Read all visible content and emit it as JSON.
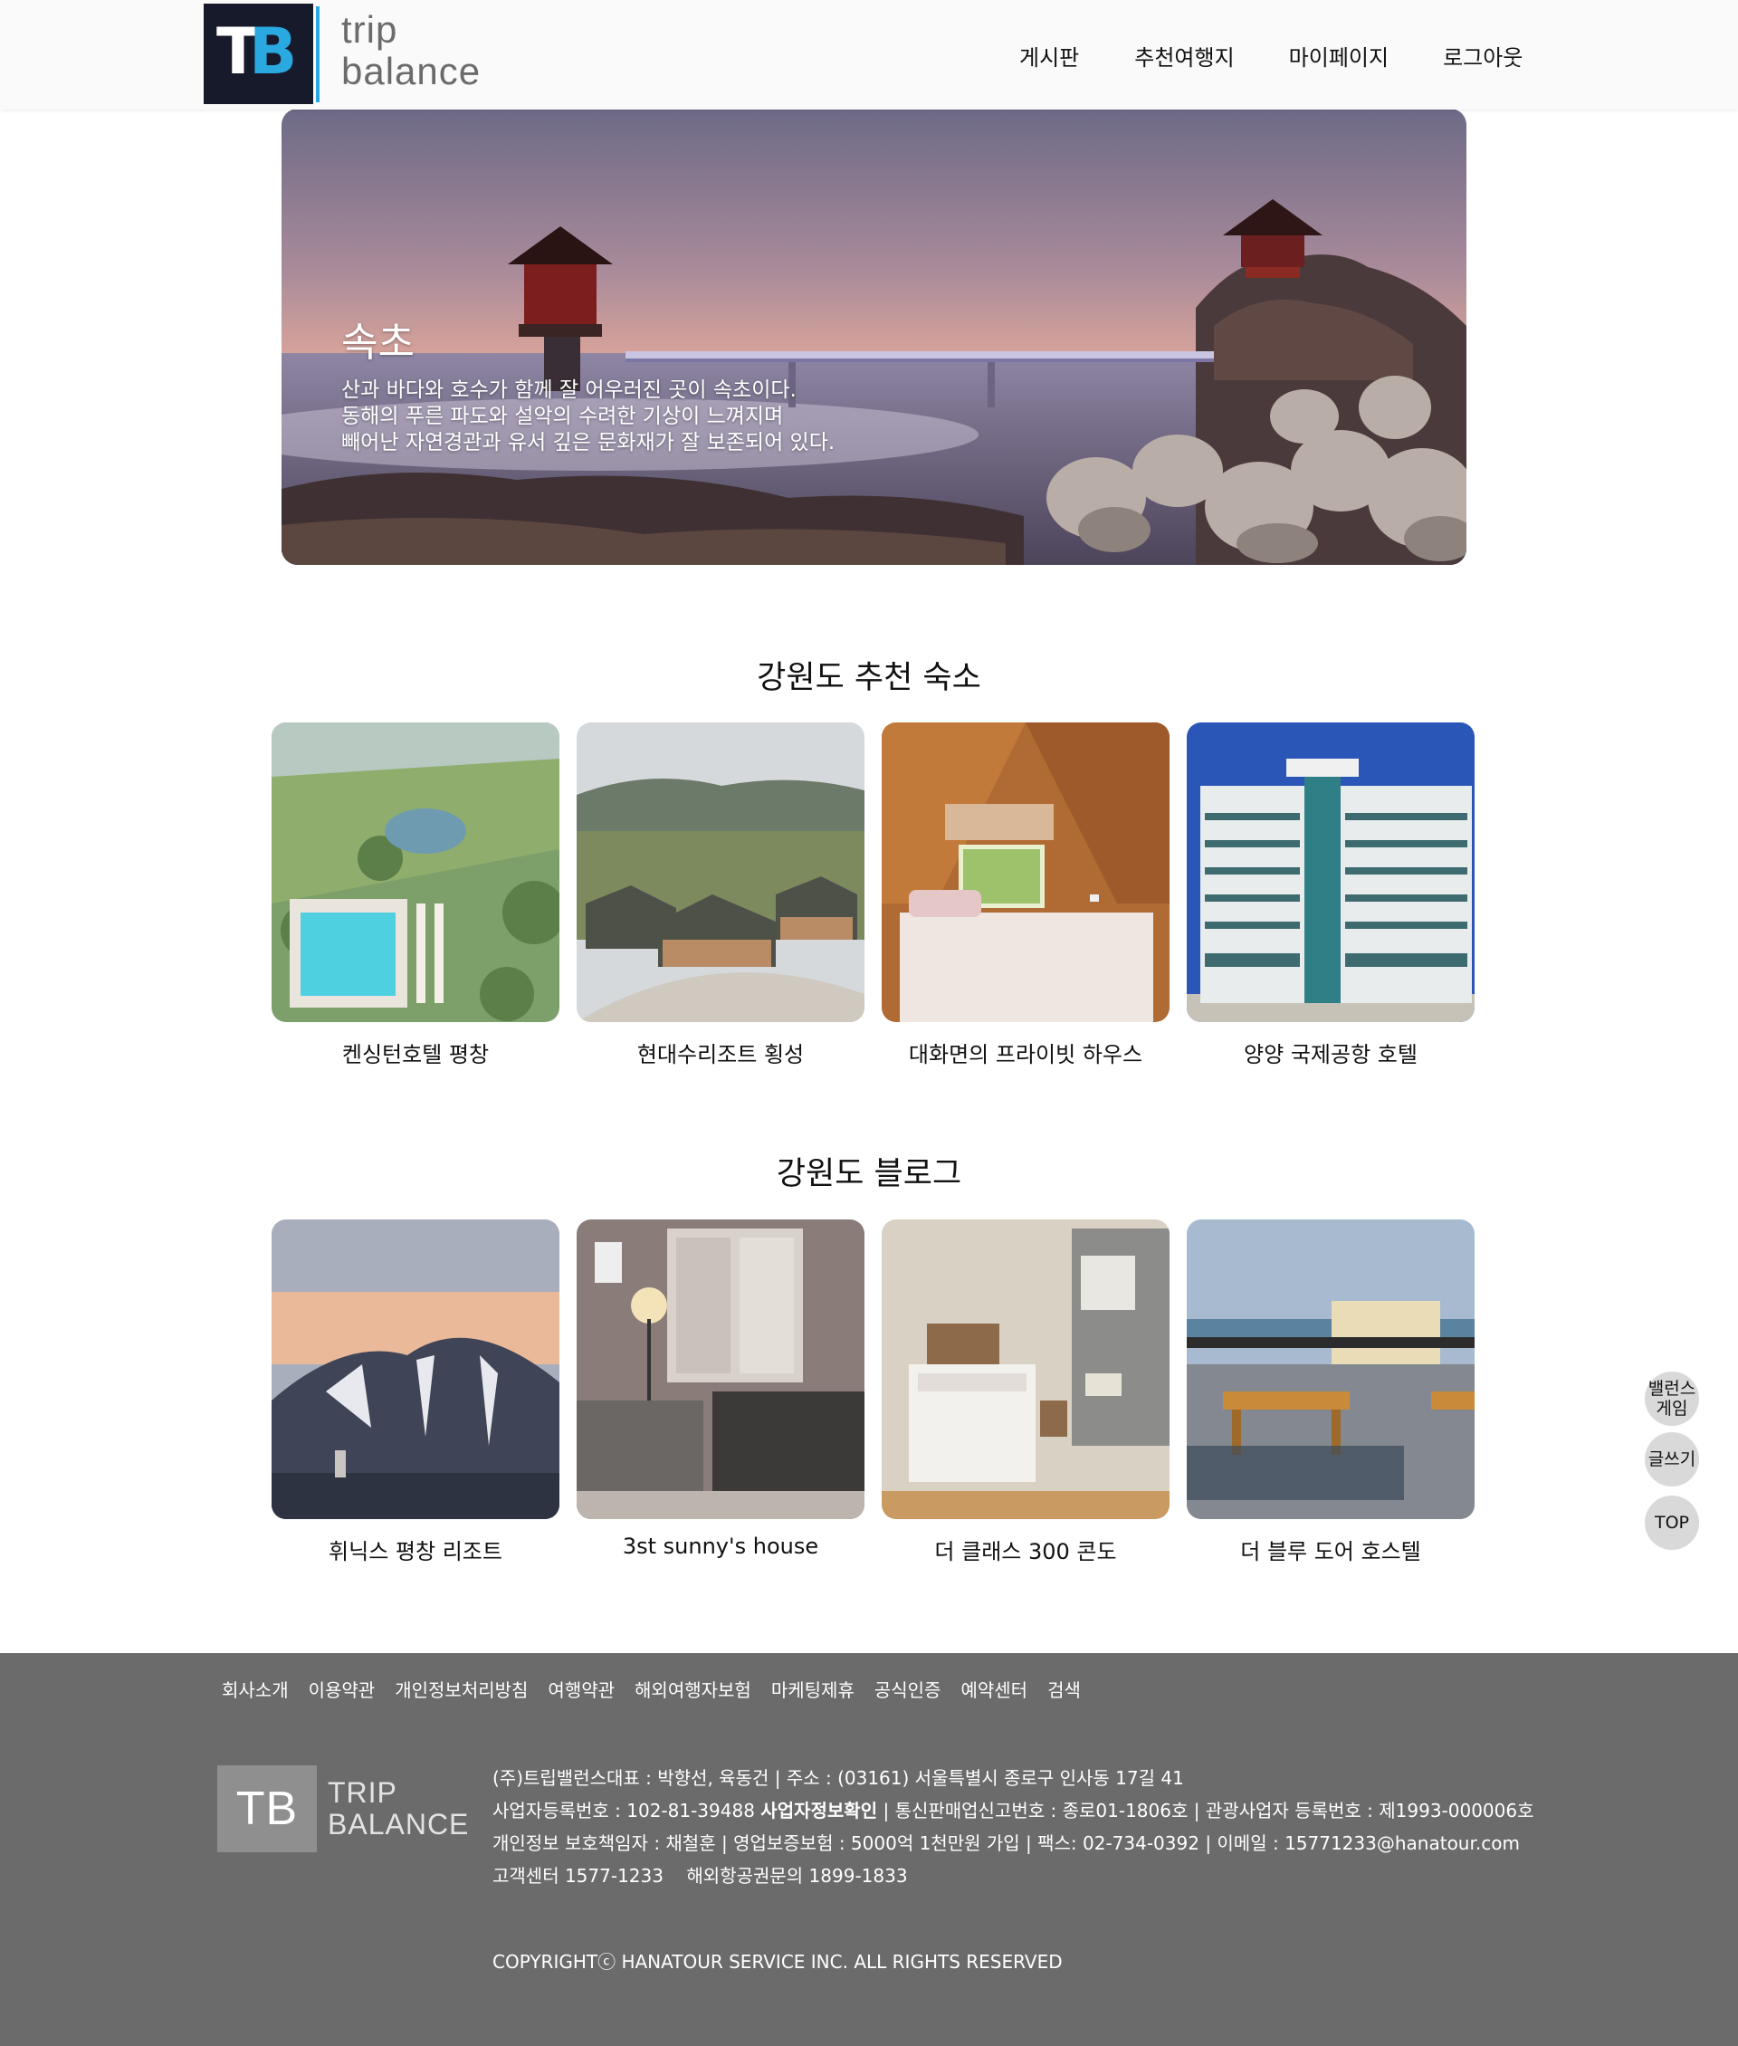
{
  "header": {
    "logo_mark": "TB",
    "logo_text_line1": "trip",
    "logo_text_line2": "balance",
    "nav": [
      "게시판",
      "추천여행지",
      "마이페이지",
      "로그아웃"
    ]
  },
  "hero": {
    "title": "속초",
    "desc_line1": "산과 바다와 호수가 함께 잘 어우러진 곳이 속초이다.",
    "desc_line2": "동해의 푸른 파도와 설악의 수려한 기상이 느껴지며",
    "desc_line3": "빼어난 자연경관과 유서 깊은 문화재가 잘 보존되어 있다."
  },
  "stay_section": {
    "title": "강원도 추천 숙소",
    "items": [
      "켄싱턴호텔 평창",
      "현대수리조트 횡성",
      "대화면의 프라이빗 하우스",
      "양양 국제공항 호텔"
    ]
  },
  "blog_section": {
    "title": "강원도 블로그",
    "items": [
      "휘닉스 평창 리조트",
      "3st sunny's house",
      "더 클래스 300 콘도",
      "더 블루 도어 호스텔"
    ]
  },
  "floating": {
    "balance_game_line1": "밸런스",
    "balance_game_line2": "게임",
    "write": "글쓰기",
    "top": "TOP"
  },
  "footer": {
    "links": [
      "회사소개",
      "이용약관",
      "개인정보처리방침",
      "여행약관",
      "해외여행자보험",
      "마케팅제휴",
      "공식인증",
      "예약센터",
      "검색"
    ],
    "logo_box": "TB",
    "logo_name_line1": "TRIP",
    "logo_name_line2": "BALANCE",
    "info_line1": "(주)트립밸런스대표 : 박향선, 육동건 | 주소 : (03161) 서울특별시 종로구 인사동 17길 41",
    "info_line2_a": "사업자등록번호 : 102-81-39488 ",
    "info_line2_b": "사업자정보확인",
    "info_line2_c": " | 통신판매업신고번호 : 종로01-1806호 | 관광사업자 등록번호 : 제1993-000006호",
    "info_line3": "개인정보 보호책임자 : 채철훈 | 영업보증보험 : 5000억 1천만원 가입 | 팩스: 02-734-0392 | 이메일 : 15771233@hanatour.com",
    "info_line4": "고객센터 1577-1233    해외항공권문의 1899-1833",
    "copyright": "COPYRIGHTⓒ HANATOUR SERVICE INC. ALL RIGHTS RESERVED"
  },
  "colors": {
    "accent": "#2aa8e0",
    "footer_bg": "#6b6b6b",
    "header_bg": "#fafafa",
    "float_btn": "#d9d9d9"
  }
}
